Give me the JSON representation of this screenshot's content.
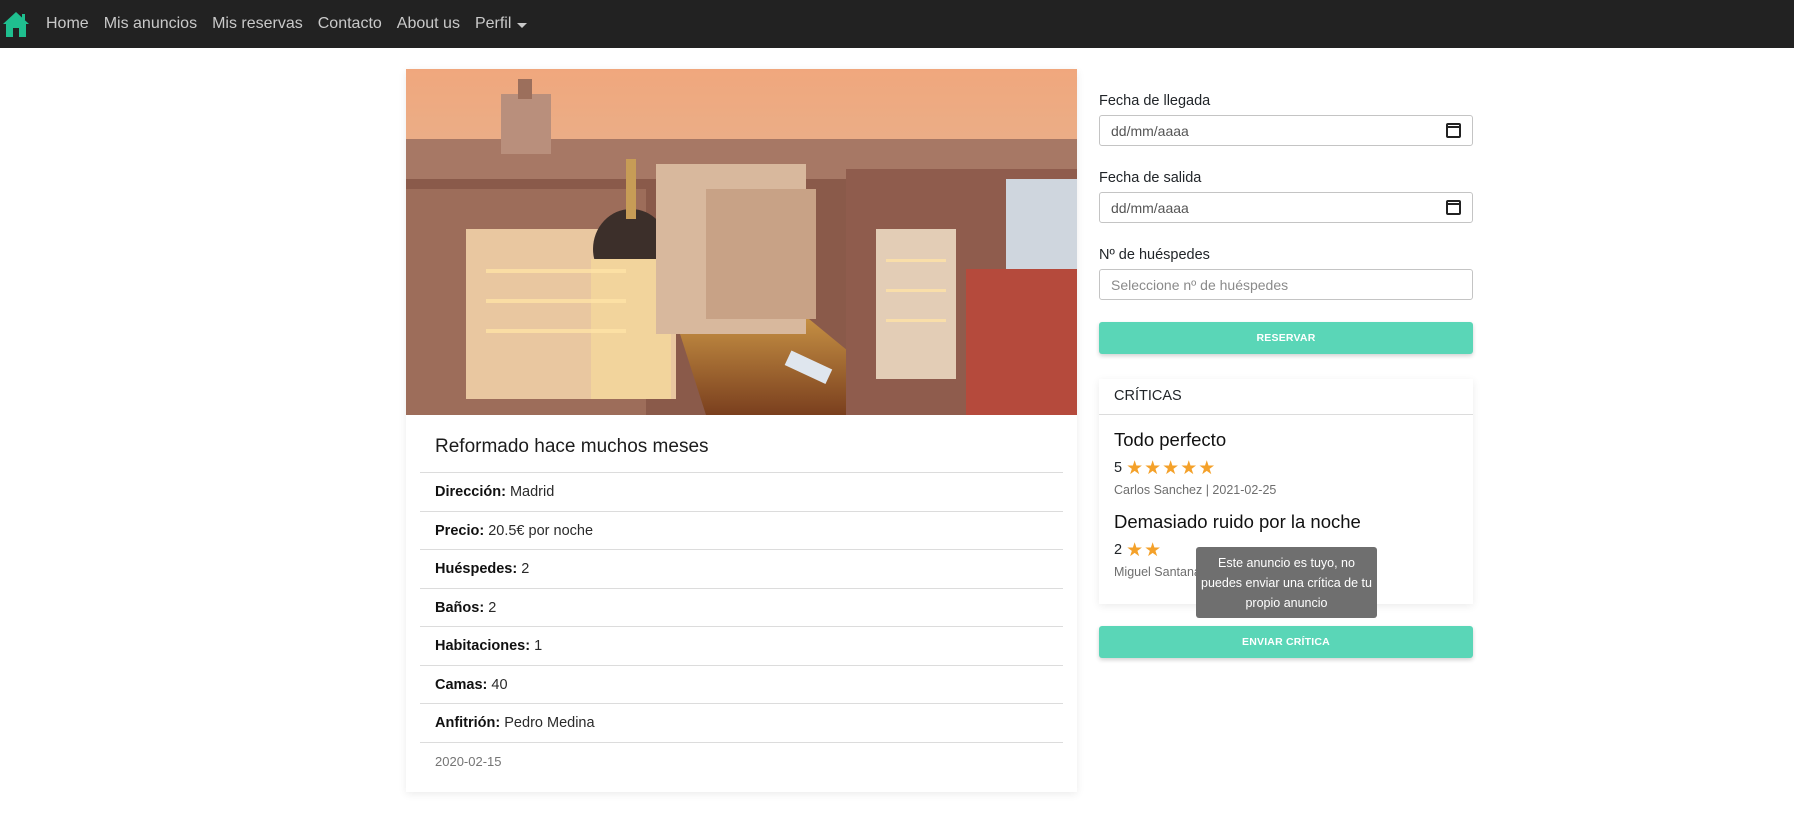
{
  "navbar": {
    "brand_icon": "home-icon",
    "brand_color": "#1fbf8f",
    "links": [
      "Home",
      "Mis anuncios",
      "Mis reservas",
      "Contacto",
      "About us"
    ],
    "profile_label": "Perfil"
  },
  "listing": {
    "photo_icon": "city-photo",
    "title": "Reformado hace muchos meses",
    "rows": [
      {
        "label": "Dirección:",
        "value": "Madrid"
      },
      {
        "label": "Precio:",
        "value": "20.5€ por noche"
      },
      {
        "label": "Huéspedes:",
        "value": "2"
      },
      {
        "label": "Baños:",
        "value": "2"
      },
      {
        "label": "Habitaciones:",
        "value": "1"
      },
      {
        "label": "Camas:",
        "value": "40"
      },
      {
        "label": "Anfitrión:",
        "value": "Pedro Medina"
      }
    ],
    "date": "2020-02-15"
  },
  "booking": {
    "arrival_label": "Fecha de llegada",
    "arrival_placeholder": "dd/mm/aaaa",
    "departure_label": "Fecha de salida",
    "departure_placeholder": "dd/mm/aaaa",
    "guests_label": "Nº de huéspedes",
    "guests_placeholder": "Seleccione nº de huéspedes",
    "reserve_button": "RESERVAR"
  },
  "reviews": {
    "header": "CRÍTICAS",
    "items": [
      {
        "title": "Todo perfecto",
        "rating": 5,
        "rating_text": "5",
        "meta": "Carlos Sanchez | 2021-02-25"
      },
      {
        "title": "Demasiado ruido por la noche",
        "rating": 2,
        "rating_text": "2",
        "meta": "Miguel Santana"
      }
    ],
    "send_button": "ENVIAR CRÍTICA"
  },
  "tooltip": {
    "text": "Este anuncio es tuyo, no puedes enviar una crítica de tu propio anuncio"
  },
  "colors": {
    "accent": "#5ad6b7",
    "navbar": "#222222",
    "star": "#f4a12a"
  }
}
